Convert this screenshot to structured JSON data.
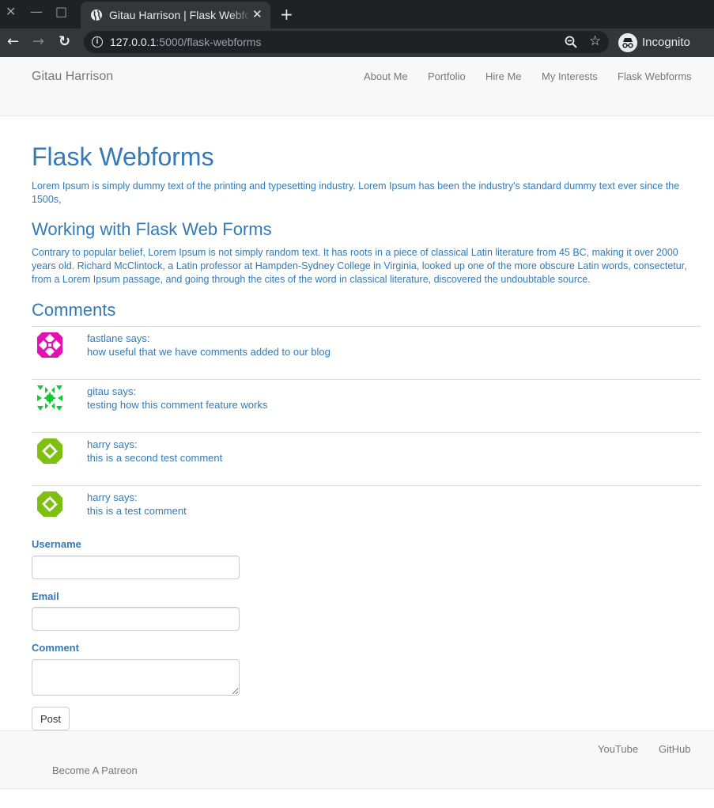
{
  "browser": {
    "tab_title": "Gitau Harrison | Flask Webforms",
    "tab_close": "✕",
    "new_tab": "+",
    "url_host": "127.0.0.1",
    "url_rest": ":5000/flask-webforms",
    "profile_label": "Incognito",
    "min_glyph": "—",
    "max_glyph": "□",
    "close_glyph": "✕",
    "back_glyph": "←",
    "forward_glyph": "→",
    "reload_glyph": "↻",
    "star_glyph": "☆",
    "info_glyph": "i"
  },
  "navbar": {
    "brand": "Gitau Harrison",
    "links": [
      "About Me",
      "Portfolio",
      "Hire Me",
      "My Interests",
      "Flask Webforms"
    ]
  },
  "main": {
    "title": "Flask Webforms",
    "intro": "Lorem Ipsum is simply dummy text of the printing and typesetting industry. Lorem Ipsum has been the industry's standard dummy text ever since the 1500s,",
    "section_title": "Working with Flask Web Forms",
    "section_text": "Contrary to popular belief, Lorem Ipsum is not simply random text. It has roots in a piece of classical Latin literature from 45 BC, making it over 2000 years old. Richard McClintock, a Latin professor at Hampden-Sydney College in Virginia, looked up one of the more obscure Latin words, consectetur, from a Lorem Ipsum passage, and going through the cites of the word in classical literature, discovered the undoubtable source.",
    "comments_title": "Comments"
  },
  "comments": [
    {
      "author": "fastlane says:",
      "text": "how useful that we have comments added to our blog",
      "avatar_color": "#e60fb4"
    },
    {
      "author": "gitau says:",
      "text": "testing how this comment feature works",
      "avatar_color": "#12c933"
    },
    {
      "author": "harry says:",
      "text": "this is a second test comment",
      "avatar_color": "#7fbf12"
    },
    {
      "author": "harry says:",
      "text": "this is a test comment",
      "avatar_color": "#7fbf12"
    }
  ],
  "form": {
    "username_label": "Username",
    "email_label": "Email",
    "comment_label": "Comment",
    "submit_label": "Post"
  },
  "footer": {
    "youtube": "YouTube",
    "github": "GitHub",
    "patreon": "Become A Patreon"
  },
  "colors": {
    "link": "#337ab7",
    "muted": "#777777",
    "chrome_dark": "#202124",
    "chrome_mid": "#35363a"
  }
}
